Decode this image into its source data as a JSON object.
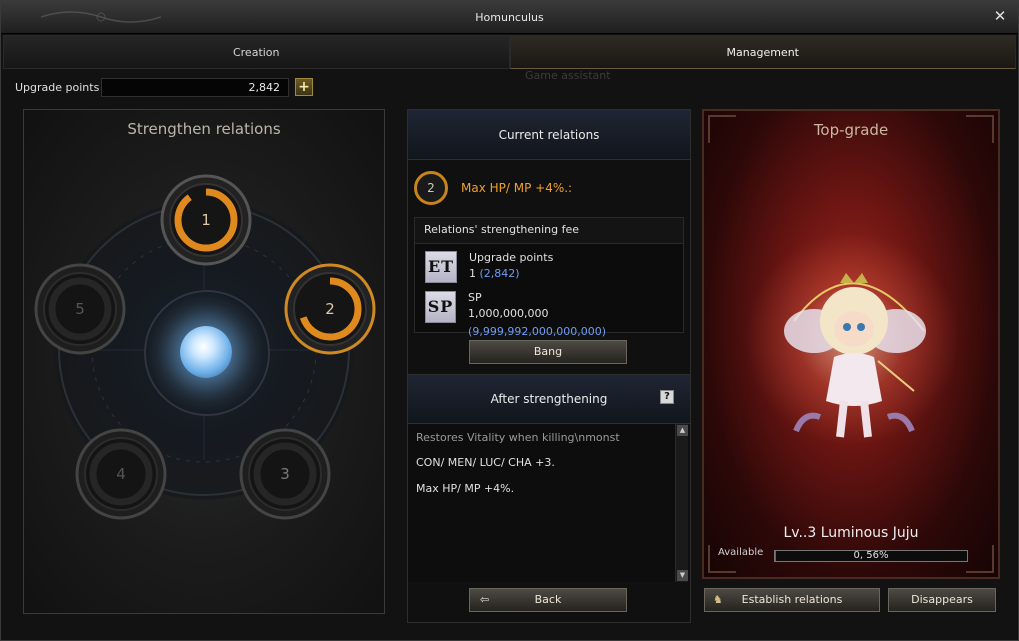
{
  "window": {
    "title": "Homunculus"
  },
  "tabs": [
    {
      "label": "Creation",
      "active": false
    },
    {
      "label": "Management",
      "active": true
    }
  ],
  "ghost_text": "Game assistant",
  "upgrade": {
    "label": "Upgrade points",
    "value": "2,842"
  },
  "left": {
    "heading": "Strengthen relations",
    "nodes": [
      {
        "label": "1",
        "progress": 0.9,
        "active": true
      },
      {
        "label": "2",
        "progress": 0.7,
        "active": true
      },
      {
        "label": "3",
        "progress": 0,
        "active": false
      },
      {
        "label": "4",
        "progress": 0,
        "active": false
      },
      {
        "label": "5",
        "progress": 0,
        "active": false
      }
    ]
  },
  "middle": {
    "current_header": "Current relations",
    "current_level": "2",
    "current_effect": "Max HP/ MP +4%.:",
    "fee_title": "Relations' strengthening fee",
    "fees": [
      {
        "icon_text": "ET",
        "icon": "et-token-icon",
        "name": "Upgrade points",
        "amount": "1",
        "available": "(2,842)"
      },
      {
        "icon_text": "SP",
        "icon": "sp-token-icon",
        "name": "SP",
        "amount": "1,000,000,000",
        "available": "(9,999,992,000,000,000)"
      }
    ],
    "bang_label": "Bang",
    "after_header": "After strengthening",
    "help_label": "?",
    "effects": [
      "Restores Vitality when killing\\nmonst",
      "CON/ MEN/ LUC/ CHA +3.",
      "Max HP/ MP +4%."
    ],
    "back_label": "Back"
  },
  "right": {
    "heading": "Top-grade",
    "char_name": "Lv..3 Luminous Juju",
    "available_label": "Available",
    "available_percent": 0.56,
    "available_text": "0, 56%"
  },
  "buttons": {
    "establish": "Establish relations",
    "disappears": "Disappears"
  },
  "colors": {
    "accent_orange": "#e08a1e",
    "link_blue": "#6f9cf5",
    "effect_orange": "#f0a030"
  }
}
